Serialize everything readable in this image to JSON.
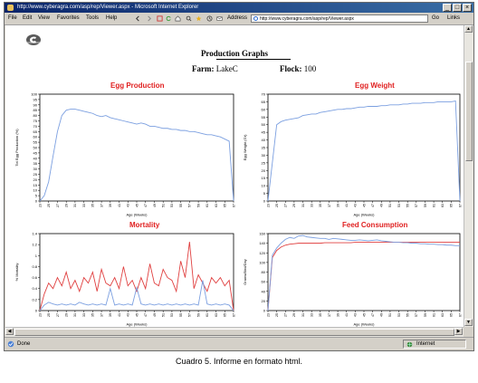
{
  "window": {
    "title": "http://www.cyberagra.com/asp/rep/Viewer.aspx - Microsoft Internet Explorer",
    "menu": [
      "File",
      "Edit",
      "View",
      "Favorites",
      "Tools",
      "Help"
    ],
    "address_label": "Address",
    "address_url": "http://www.cyberagra.com/asp/rep/Viewer.aspx",
    "go_label": "Go",
    "links_label": "Links",
    "status_text": "Done",
    "zone_text": "Internet"
  },
  "page": {
    "heading": "Production Graphs",
    "farm_label": "Farm:",
    "farm_value": "LakeC",
    "flock_label": "Flock:",
    "flock_value": "100"
  },
  "caption": "Cuadro 5. Informe en formato html.",
  "colors": {
    "title_red": "#e02020",
    "blue_series": "#7b9fe0",
    "red_series": "#e04040"
  },
  "chart_data": [
    {
      "type": "line",
      "title": "Egg Production",
      "xlabel": "Age (Weeks)",
      "ylabel": "Tot Egg Production (%)",
      "x": [
        23,
        24,
        25,
        26,
        27,
        28,
        29,
        30,
        31,
        32,
        33,
        34,
        35,
        36,
        37,
        38,
        39,
        40,
        41,
        42,
        43,
        44,
        45,
        46,
        47,
        48,
        49,
        50,
        51,
        52,
        53,
        54,
        55,
        56,
        57,
        58,
        59,
        60,
        61,
        62,
        63,
        64,
        65,
        66,
        67
      ],
      "xlim": [
        23,
        67
      ],
      "ylim": [
        0,
        100
      ],
      "yticks": [
        0,
        5,
        10,
        15,
        20,
        25,
        30,
        35,
        40,
        45,
        50,
        55,
        60,
        65,
        70,
        75,
        80,
        85,
        90,
        95,
        100
      ],
      "series": [
        {
          "color": "#7b9fe0",
          "values": [
            0,
            5,
            18,
            42,
            65,
            80,
            85,
            86,
            86,
            85,
            84,
            83,
            82,
            80,
            79,
            80,
            78,
            77,
            76,
            75,
            74,
            73,
            72,
            73,
            72,
            70,
            70,
            69,
            68,
            68,
            67,
            67,
            66,
            66,
            65,
            65,
            64,
            63,
            62,
            62,
            61,
            60,
            58,
            56,
            0
          ]
        }
      ]
    },
    {
      "type": "line",
      "title": "Egg Weight",
      "xlabel": "Age (Weeks)",
      "ylabel": "Egg Weight (Gr)",
      "x": [
        23,
        24,
        25,
        26,
        27,
        28,
        29,
        30,
        31,
        32,
        33,
        34,
        35,
        36,
        37,
        38,
        39,
        40,
        41,
        42,
        43,
        44,
        45,
        46,
        47,
        48,
        49,
        50,
        51,
        52,
        53,
        54,
        55,
        56,
        57,
        58,
        59,
        60,
        61,
        62,
        63,
        64,
        65,
        66,
        67
      ],
      "xlim": [
        23,
        67
      ],
      "ylim": [
        0,
        70
      ],
      "yticks": [
        0,
        5,
        10,
        15,
        20,
        25,
        30,
        35,
        40,
        45,
        50,
        55,
        60,
        65,
        70
      ],
      "series": [
        {
          "color": "#7b9fe0",
          "values": [
            0,
            25,
            50,
            52,
            53,
            53.5,
            54,
            54.5,
            56,
            56.5,
            57,
            57,
            58,
            58.5,
            59,
            59.5,
            60,
            60,
            60.5,
            60.5,
            61,
            61.5,
            61.5,
            62,
            62,
            62,
            62.5,
            62.5,
            63,
            63,
            63,
            63.5,
            63.5,
            64,
            64,
            64,
            64.5,
            64.5,
            64.5,
            65,
            65,
            65,
            65,
            65.5,
            0
          ]
        }
      ]
    },
    {
      "type": "line",
      "title": "Mortality",
      "xlabel": "Age (Weeks)",
      "ylabel": "% Mortality",
      "x": [
        23,
        24,
        25,
        26,
        27,
        28,
        29,
        30,
        31,
        32,
        33,
        34,
        35,
        36,
        37,
        38,
        39,
        40,
        41,
        42,
        43,
        44,
        45,
        46,
        47,
        48,
        49,
        50,
        51,
        52,
        53,
        54,
        55,
        56,
        57,
        58,
        59,
        60,
        61,
        62,
        63,
        64,
        65,
        66,
        67
      ],
      "xlim": [
        23,
        67
      ],
      "ylim": [
        0,
        1.4
      ],
      "yticks": [
        0,
        0.2,
        0.4,
        0.6,
        0.8,
        1,
        1.2,
        1.4
      ],
      "series": [
        {
          "color": "#e04040",
          "values": [
            0,
            0.3,
            0.5,
            0.4,
            0.6,
            0.45,
            0.7,
            0.4,
            0.55,
            0.35,
            0.6,
            0.5,
            0.7,
            0.35,
            0.75,
            0.5,
            0.45,
            0.6,
            0.4,
            0.8,
            0.45,
            0.55,
            0.35,
            0.6,
            0.4,
            0.85,
            0.5,
            0.45,
            0.75,
            0.6,
            0.55,
            0.35,
            0.9,
            0.6,
            1.25,
            0.4,
            0.65,
            0.5,
            0.35,
            0.6,
            0.5,
            0.6,
            0.45,
            0.55,
            0
          ]
        },
        {
          "color": "#7b9fe0",
          "values": [
            0,
            0.1,
            0.15,
            0.12,
            0.1,
            0.12,
            0.1,
            0.12,
            0.1,
            0.15,
            0.12,
            0.1,
            0.12,
            0.1,
            0.12,
            0.1,
            0.4,
            0.1,
            0.12,
            0.1,
            0.12,
            0.1,
            0.42,
            0.12,
            0.1,
            0.12,
            0.1,
            0.12,
            0.1,
            0.12,
            0.1,
            0.12,
            0.1,
            0.12,
            0.1,
            0.12,
            0.1,
            0.55,
            0.12,
            0.1,
            0.12,
            0.1,
            0.12,
            0.1,
            0
          ]
        }
      ]
    },
    {
      "type": "line",
      "title": "Feed Consumption",
      "xlabel": "Age (Weeks)",
      "ylabel": "Grams/Bird/Day",
      "x": [
        23,
        24,
        25,
        26,
        27,
        28,
        29,
        30,
        31,
        32,
        33,
        34,
        35,
        36,
        37,
        38,
        39,
        40,
        41,
        42,
        43,
        44,
        45,
        46,
        47,
        48,
        49,
        50,
        51,
        52,
        53,
        54,
        55,
        56,
        57,
        58,
        59,
        60,
        61,
        62,
        63,
        64,
        65,
        66,
        67
      ],
      "xlim": [
        23,
        67
      ],
      "ylim": [
        0,
        160
      ],
      "yticks": [
        0,
        20,
        40,
        60,
        80,
        100,
        120,
        140,
        160
      ],
      "series": [
        {
          "color": "#e04040",
          "values": [
            0,
            110,
            125,
            132,
            136,
            138,
            139,
            140,
            140,
            140,
            140,
            140,
            140,
            141,
            141,
            141,
            141,
            141,
            141,
            141,
            142,
            142,
            142,
            142,
            142,
            142,
            142,
            142,
            142,
            142,
            142,
            142,
            142,
            142,
            142,
            142,
            142,
            142,
            142,
            142,
            142,
            142,
            142,
            142,
            142
          ]
        },
        {
          "color": "#7b9fe0",
          "values": [
            0,
            115,
            130,
            140,
            148,
            152,
            150,
            155,
            156,
            153,
            152,
            151,
            150,
            150,
            148,
            150,
            149,
            148,
            147,
            146,
            146,
            147,
            146,
            145,
            146,
            147,
            145,
            144,
            143,
            142,
            142,
            141,
            141,
            140,
            140,
            139,
            139,
            138,
            138,
            137,
            137,
            136,
            136,
            135,
            135
          ]
        }
      ]
    }
  ]
}
